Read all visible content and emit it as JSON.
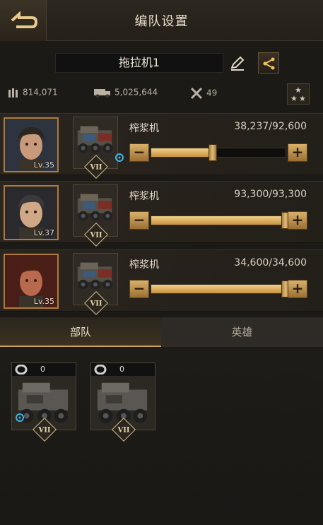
{
  "header": {
    "title": "编队设置"
  },
  "squad": {
    "name": "拖拉机1"
  },
  "stats": {
    "ammo": "814,071",
    "fuel": "5,025,644",
    "parts": "49"
  },
  "slots": [
    {
      "hero": {
        "level": "Lv.35"
      },
      "vehicle": {
        "rank": "VII",
        "has_gear": true
      },
      "unit": {
        "name": "榨浆机",
        "count": "38,237/92,600",
        "fill": 0.46
      }
    },
    {
      "hero": {
        "level": "Lv.37"
      },
      "vehicle": {
        "rank": "VII",
        "has_gear": false
      },
      "unit": {
        "name": "榨浆机",
        "count": "93,300/93,300",
        "fill": 1.0
      }
    },
    {
      "hero": {
        "level": "Lv.35"
      },
      "vehicle": {
        "rank": "VII",
        "has_gear": false
      },
      "unit": {
        "name": "榨浆机",
        "count": "34,600/34,600",
        "fill": 1.0
      }
    }
  ],
  "slider": {
    "minus": "−",
    "plus": "+"
  },
  "tabs": {
    "troops": "部队",
    "heroes": "英雄"
  },
  "reserve": [
    {
      "count": "0",
      "rank": "VII",
      "has_gear": true
    },
    {
      "count": "0",
      "rank": "VII",
      "has_gear": false
    }
  ],
  "colors": {
    "accent": "#caa056",
    "slider_fill": "#e0b36a",
    "border_gold": "#b07a3a"
  },
  "icons": [
    "back-icon",
    "edit-icon",
    "share-icon",
    "ammo-icon",
    "fuel-truck-icon",
    "wrench-icon",
    "stars-icon",
    "gear-icon",
    "tire-icon"
  ]
}
